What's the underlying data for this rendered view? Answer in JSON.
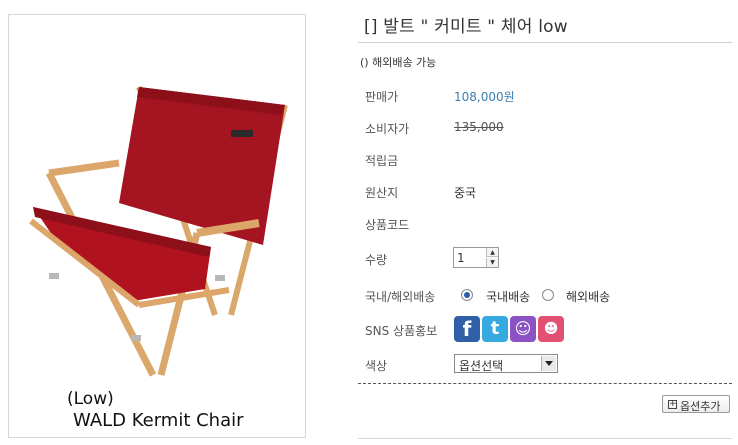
{
  "product": {
    "image_caption_line1": "(Low)",
    "image_caption_line2": "WALD Kermit Chair",
    "chair_tag": "WALDKERMIT"
  },
  "title": "[] 발트 \" 커미트 \" 체어 low",
  "shipping_note": "() 해외배송 가능",
  "rows": {
    "sale_price_label": "판매가",
    "sale_price_value": "108,000원",
    "consumer_price_label": "소비자가",
    "consumer_price_value": "135,000",
    "points_label": "적립금",
    "origin_label": "원산지",
    "origin_value": "중국",
    "code_label": "상품코드",
    "qty_label": "수량",
    "qty_value": "1",
    "shipping_label": "국내/해외배송",
    "shipping_domestic": "국내배송",
    "shipping_overseas": "해외배송",
    "sns_label": "SNS 상품홍보",
    "color_label": "색상",
    "color_select_value": "옵션선택"
  },
  "buttons": {
    "add_option": "옵션추가"
  },
  "colors": {
    "price": "#3a7db0",
    "facebook": "#2f5fa7",
    "twitter": "#35a9e0",
    "me2day": "#8a52c3",
    "yozm": "#e25173"
  }
}
